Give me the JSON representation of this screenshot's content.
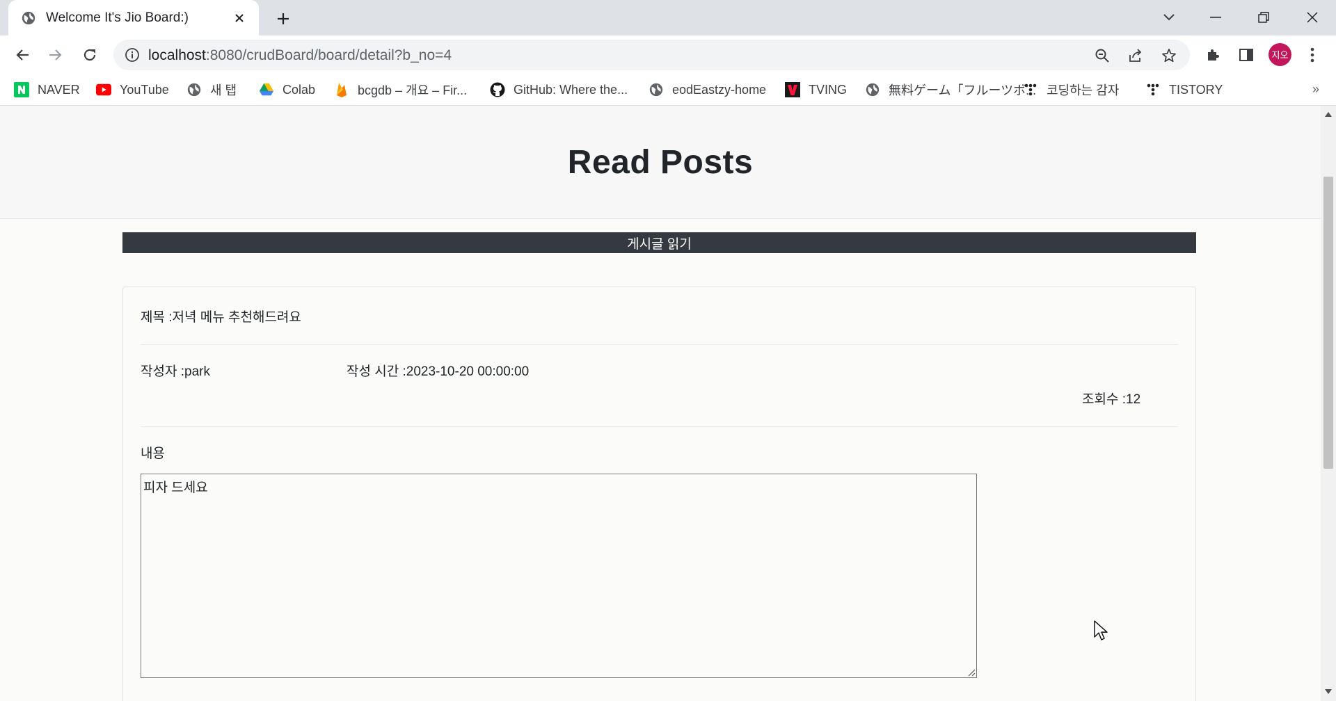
{
  "browser": {
    "tab_title": "Welcome It's Jio Board:)",
    "url_host": "localhost",
    "url_path": ":8080/crudBoard/board/detail?b_no=4",
    "profile_initials": "지오",
    "bookmarks": [
      {
        "label": "NAVER",
        "icon": "naver-icon"
      },
      {
        "label": "YouTube",
        "icon": "youtube-icon"
      },
      {
        "label": "새 탭",
        "icon": "globe-icon"
      },
      {
        "label": "Colab",
        "icon": "drive-icon"
      },
      {
        "label": "bcgdb – 개요 – Fir...",
        "icon": "firebase-icon"
      },
      {
        "label": "GitHub: Where the...",
        "icon": "github-icon"
      },
      {
        "label": "eodEastzy-home",
        "icon": "globe-icon"
      },
      {
        "label": "TVING",
        "icon": "tving-icon"
      },
      {
        "label": "無料ゲーム「フルーツボ...",
        "icon": "globe-icon"
      },
      {
        "label": "코딩하는 감자",
        "icon": "tistory-icon"
      },
      {
        "label": "TISTORY",
        "icon": "tistory-icon"
      }
    ],
    "more_bookmarks": "»"
  },
  "page": {
    "title": "Read Posts",
    "section_header": "게시글 읽기",
    "subject_label": "제목 :",
    "subject_value": "저녁 메뉴 추천해드려요",
    "author_label": "작성자 :",
    "author_value": "park",
    "time_label": "작성 시간 :",
    "time_value": "2023-10-20 00:00:00",
    "views_label": "조회수 :",
    "views_value": "12",
    "content_label": "내용",
    "content_value": "피자 드세요"
  },
  "colors": {
    "section_bar": "#343a40",
    "avatar": "#c2185b"
  }
}
